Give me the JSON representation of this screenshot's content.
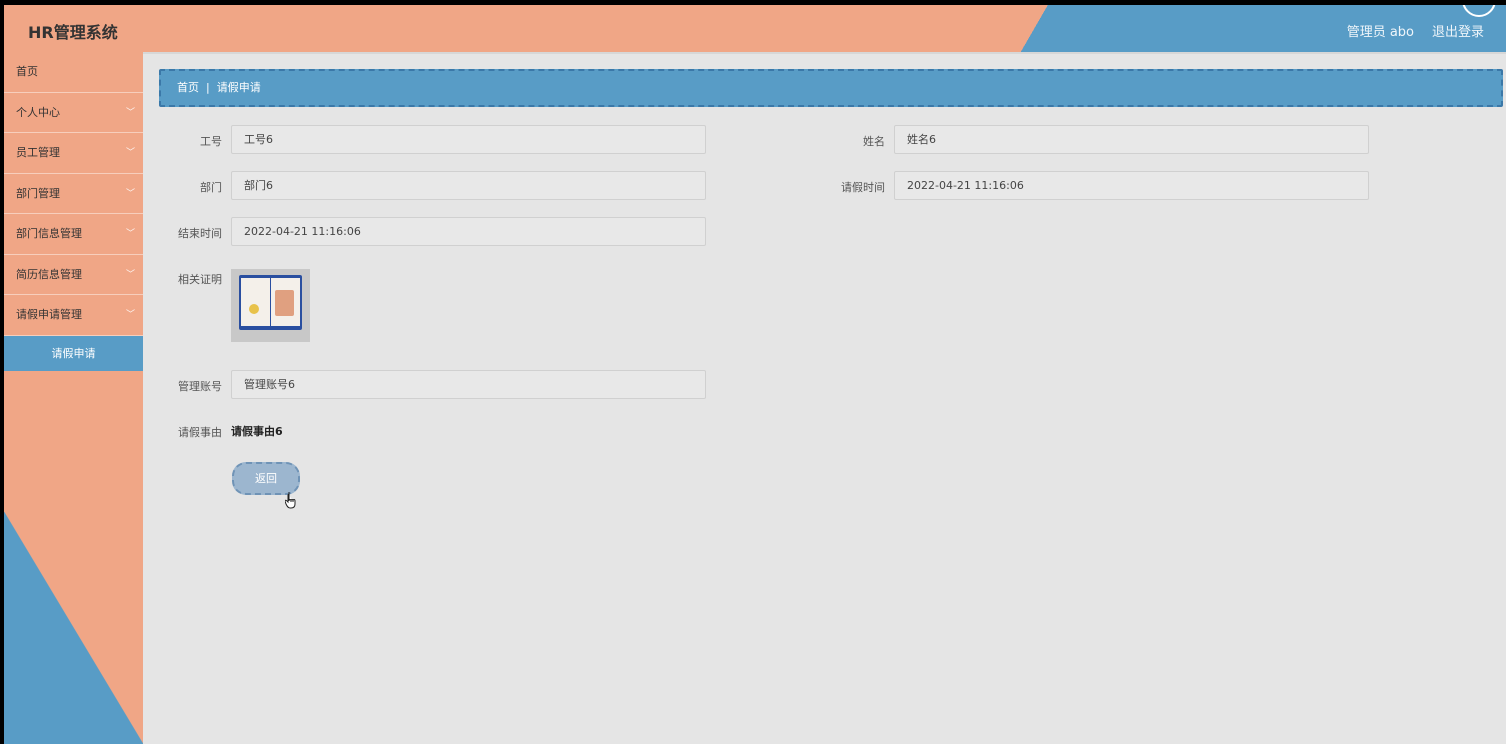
{
  "header": {
    "app_title": "HR管理系统",
    "user_label": "管理员 abo",
    "logout_label": "退出登录"
  },
  "sidebar": {
    "items": [
      {
        "label": "首页",
        "expandable": false
      },
      {
        "label": "个人中心",
        "expandable": true
      },
      {
        "label": "员工管理",
        "expandable": true
      },
      {
        "label": "部门管理",
        "expandable": true
      },
      {
        "label": "部门信息管理",
        "expandable": true
      },
      {
        "label": "简历信息管理",
        "expandable": true
      },
      {
        "label": "请假申请管理",
        "expandable": true
      }
    ],
    "active_subitem": "请假申请"
  },
  "breadcrumb": {
    "home": "首页",
    "separator": "|",
    "current": "请假申请"
  },
  "form": {
    "employee_id": {
      "label": "工号",
      "value": "工号6"
    },
    "name": {
      "label": "姓名",
      "value": "姓名6"
    },
    "department": {
      "label": "部门",
      "value": "部门6"
    },
    "leave_time": {
      "label": "请假时间",
      "value": "2022-04-21 11:16:06"
    },
    "end_time": {
      "label": "结束时间",
      "value": "2022-04-21 11:16:06"
    },
    "proof": {
      "label": "相关证明"
    },
    "admin_account": {
      "label": "管理账号",
      "value": "管理账号6"
    },
    "reason": {
      "label": "请假事由",
      "value": "请假事由6"
    },
    "back_label": "返回"
  },
  "colors": {
    "salmon": "#f0a686",
    "blue": "#589cc6",
    "background": "#e5e5e5"
  }
}
